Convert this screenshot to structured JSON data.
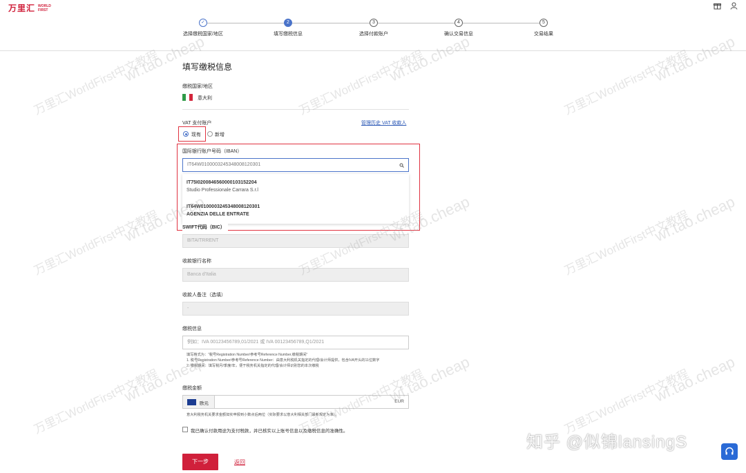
{
  "brand": {
    "logo_cn": "万里汇",
    "logo_en": "WORLD FIRST"
  },
  "topbar": {
    "gift_icon": "gift-icon",
    "user_icon": "user-icon"
  },
  "steps": [
    {
      "number": "✓",
      "label": "选择缴税国家/地区",
      "state": "done"
    },
    {
      "number": "2",
      "label": "填写缴税信息",
      "state": "active"
    },
    {
      "number": "3",
      "label": "选择付款账户",
      "state": "todo"
    },
    {
      "number": "4",
      "label": "确认交易信息",
      "state": "todo"
    },
    {
      "number": "5",
      "label": "交易结果",
      "state": "todo"
    }
  ],
  "form": {
    "title": "填写缴税信息",
    "country_label": "缴税国家/地区",
    "country_value": "意大利",
    "vat_label": "VAT 支付账户",
    "manage_link": "管理历史 VAT 收款人",
    "radio_existing": "现有",
    "radio_new": "新增",
    "iban_label": "国际银行账户号码（IBAN）",
    "iban_value": "IT64W0100003245348008120301",
    "dropdown": [
      {
        "iban": "IT75I0200846560000103152204",
        "name": "Studio Professionale Carrara S.r.l"
      },
      {
        "iban": "IT64W0100003245348008120301",
        "name": "AGENZIA DELLE ENTRATE"
      }
    ],
    "swift_label": "SWIFT代码（BIC）",
    "swift_value": "BITAITRRENT",
    "bank_label": "收款银行名称",
    "bank_value": "Banca d'Italia",
    "remark_label": "收款人备注（选填）",
    "remark_value": "-",
    "tax_info_label": "缴税信息",
    "tax_info_placeholder": "例如：IVA 00123456789,01/2021 或 IVA 00123456789,Q1/2021",
    "hint_line1": "填写格式为：“税号Registration Number/参考号Reference Number,缴税期间”",
    "hint_line2": "1. 税号Registration Number/参考号Reference Number：由意大利税机关指定的代理/会计师提供，包含IVA开头的11位数字",
    "hint_line3": "2. 缴税期间：填写税月/季度/年，便于税务机关指定的代理/会计师识别您的本次缴税",
    "amount_label": "缴税金额",
    "currency_name": "欧元",
    "currency_code": "EUR",
    "amount_note": "意大利税务机关要求金额如实申报到小数点后两位（实际要求以意大利相关部门最新规定为准）。",
    "confirm_text": "我已确认付款用途为支付税款，并已核实以上账号信息以及缴税信息的准确性。",
    "next_button": "下一步",
    "back_link": "返回"
  },
  "watermark": {
    "text1": "万里汇WorldFirst中文教程",
    "text2": "wf.tao.cheap"
  },
  "zhihu_credit": "知乎 @似锦lansingS",
  "colors": {
    "brand_red": "#d0203b",
    "accent_blue": "#4a73c9",
    "highlight_red": "#e0313f"
  }
}
